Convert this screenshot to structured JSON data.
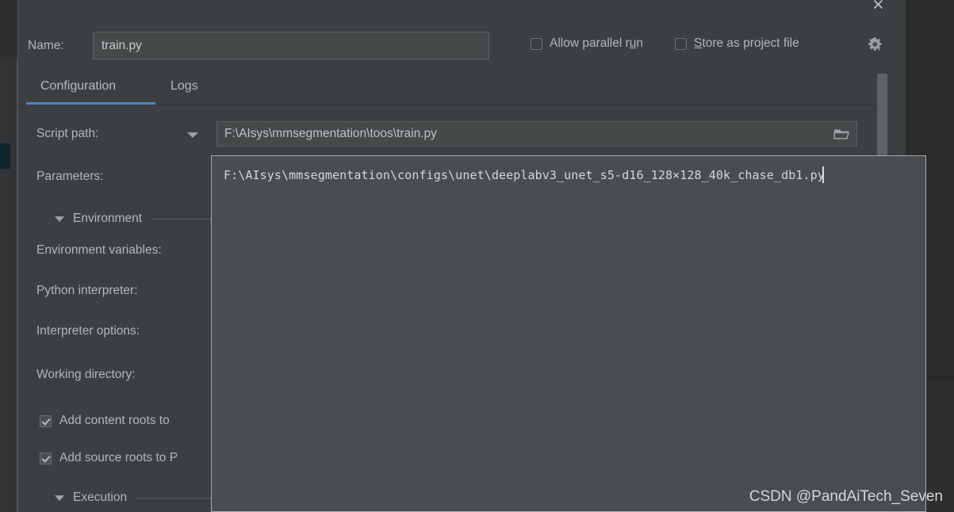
{
  "window": {
    "close_icon": "close-icon"
  },
  "name_row": {
    "label": "Name:",
    "value": "train.py",
    "placeholder": "",
    "checkboxes": [
      {
        "id": "allow-parallel-run",
        "label_before": "Allow parallel r",
        "mnemonic": "u",
        "label_after": "n",
        "checked": false
      },
      {
        "id": "store-as-project-file",
        "label_before": "",
        "mnemonic": "S",
        "label_after": "tore as project file",
        "checked": false
      }
    ],
    "gear_icon": "gear-icon"
  },
  "tabs": [
    {
      "id": "configuration",
      "label": "Configuration",
      "active": true
    },
    {
      "id": "logs",
      "label": "Logs",
      "active": false
    }
  ],
  "form": {
    "script_path": {
      "label": "Script path:",
      "value": "F:\\AIsys\\mmsegmentation\\toos\\train.py",
      "dropdown_icon": "chevron-down-icon",
      "browse_icon": "folder-icon"
    },
    "parameters": {
      "label": "Parameters:"
    },
    "environment_section": {
      "label": "Environment",
      "collapse_icon": "triangle-down-icon"
    },
    "environment_variables": {
      "label": "Environment variables:"
    },
    "python_interpreter": {
      "label": "Python interpreter:"
    },
    "interpreter_options": {
      "label": "Interpreter options:"
    },
    "working_directory": {
      "label": "Working directory:"
    },
    "add_content_roots": {
      "label": "Add content roots to",
      "checked": true
    },
    "add_source_roots": {
      "label": "Add source roots to P",
      "checked": true
    },
    "execution_section": {
      "label": "Execution",
      "collapse_icon": "triangle-down-icon"
    }
  },
  "parameters_popup": {
    "value": "F:\\AIsys\\mmsegmentation\\configs\\unet\\deeplabv3_unet_s5-d16_128×128_40k_chase_db1.py"
  },
  "watermark": {
    "text": "CSDN @PandAiTech_Seven"
  },
  "colors": {
    "dialog_bg": "#3c3f41",
    "popup_bg": "#4a4d4f",
    "accent_blue": "#4a88c7",
    "input_bg": "#45494a",
    "text": "#b2b6b9",
    "backdrop": "#2b2b2b"
  }
}
